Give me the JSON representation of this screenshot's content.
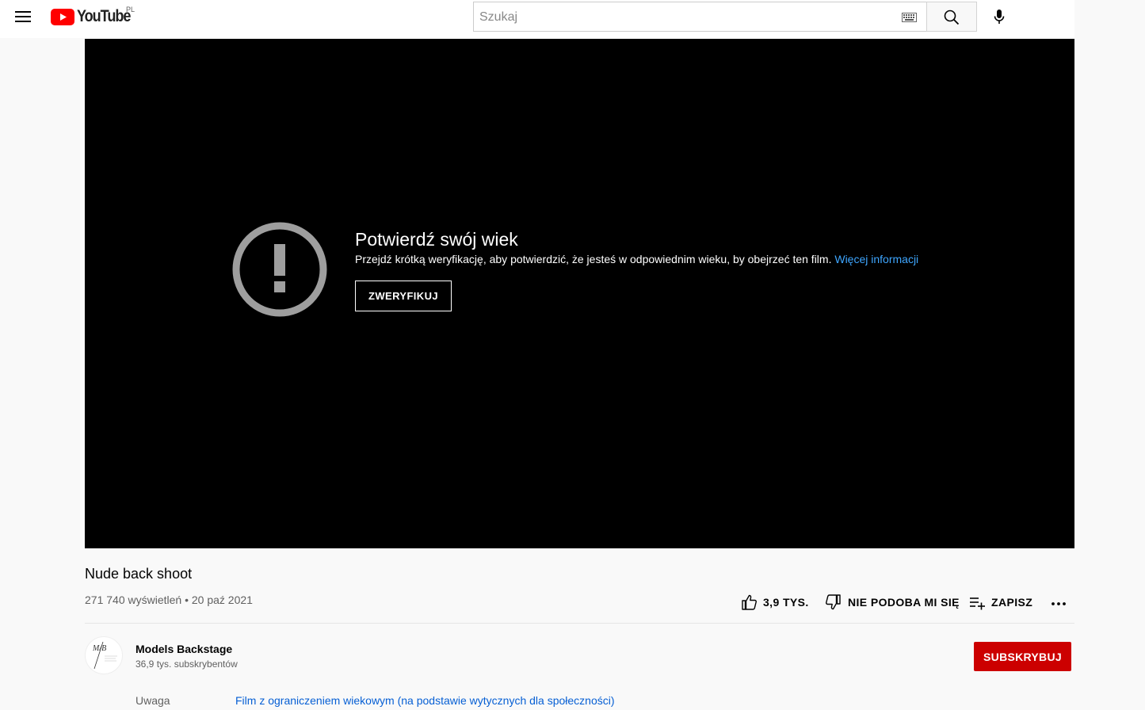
{
  "header": {
    "logo_text": "YouTube",
    "country_code": "PL",
    "search_placeholder": "Szukaj"
  },
  "player": {
    "title": "Potwierdź swój wiek",
    "description": "Przejdź krótką weryfikację, aby potwierdzić, że jesteś w odpowiednim wieku, by obejrzeć ten film.",
    "link_text": "Więcej informacji",
    "verify_button": "ZWERYFIKUJ"
  },
  "video": {
    "title": "Nude back shoot",
    "meta": "271 740 wyświetleń • 20 paź 2021",
    "actions": {
      "like_label": "3,9 TYS.",
      "dislike_label": "NIE PODOBA MI SIĘ",
      "save_label": "ZAPISZ"
    }
  },
  "channel": {
    "name": "Models Backstage",
    "subscribers": "36,9 tys. subskrybentów",
    "subscribe_button": "SUBSKRYBUJ",
    "avatar_text": "M/B"
  },
  "notice": {
    "label": "Uwaga",
    "link_text": "Film z ograniczeniem wiekowym (na podstawie wytycznych dla społeczności)"
  },
  "colors": {
    "brand_red": "#ff0000",
    "subscribe_red": "#cc0000",
    "link_blue": "#065fd4",
    "player_link_blue": "#3ea6ff"
  }
}
